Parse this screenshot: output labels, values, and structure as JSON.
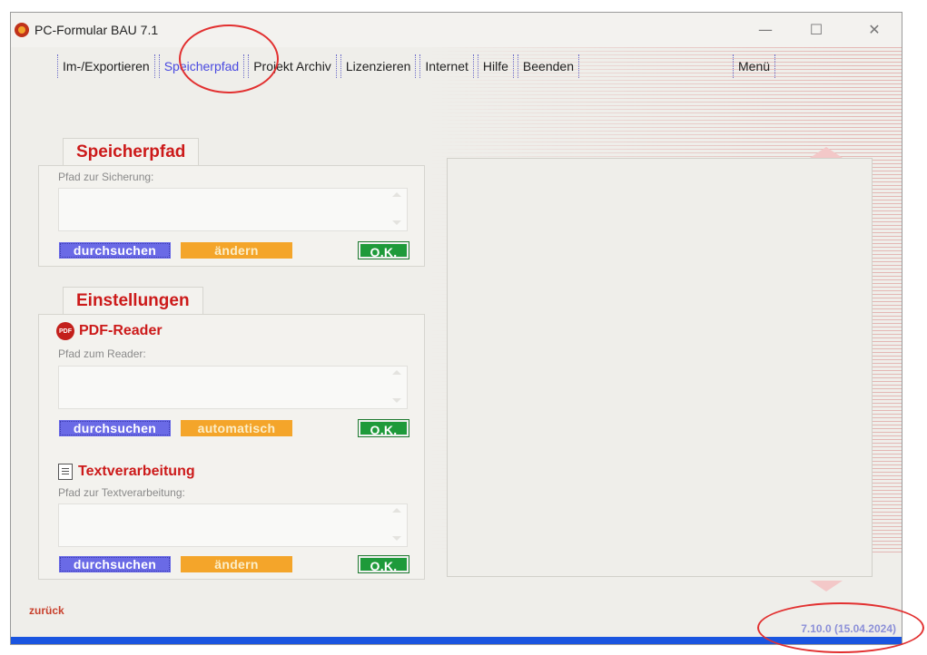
{
  "window": {
    "title": "PC-Formular BAU 7.1",
    "minimize": "—",
    "maximize": "☐",
    "close": "✕"
  },
  "menu": {
    "items": [
      "Im-/Exportieren",
      "Speicherpfad",
      "Projekt Archiv",
      "Lizenzieren",
      "Internet",
      "Hilfe",
      "Beenden"
    ],
    "active": "Speicherpfad",
    "right_item": "Menü"
  },
  "speicherpfad": {
    "tab_label": "Speicherpfad",
    "field_label": "Pfad zur Sicherung:",
    "field_value": "",
    "browse": "durchsuchen",
    "change": "ändern",
    "ok": "O.K."
  },
  "einstellungen": {
    "tab_label": "Einstellungen",
    "pdf": {
      "icon_text": "PDF",
      "title": "PDF-Reader",
      "field_label": "Pfad zum Reader:",
      "field_value": "",
      "browse": "durchsuchen",
      "auto": "automatisch",
      "ok": "O.K."
    },
    "text": {
      "title": "Textverarbeitung",
      "field_label": "Pfad zur Textverarbeitung:",
      "field_value": "",
      "browse": "durchsuchen",
      "change": "ändern",
      "ok": "O.K."
    }
  },
  "footer": {
    "back": "zurück",
    "version": "7.10.0 (15.04.2024)"
  },
  "colors": {
    "accent_red": "#cc1a1a",
    "blue_button": "#6a6ae6",
    "orange_button": "#f4a52a",
    "green_button": "#1e9a3a",
    "progress_bar": "#1a55e0"
  }
}
